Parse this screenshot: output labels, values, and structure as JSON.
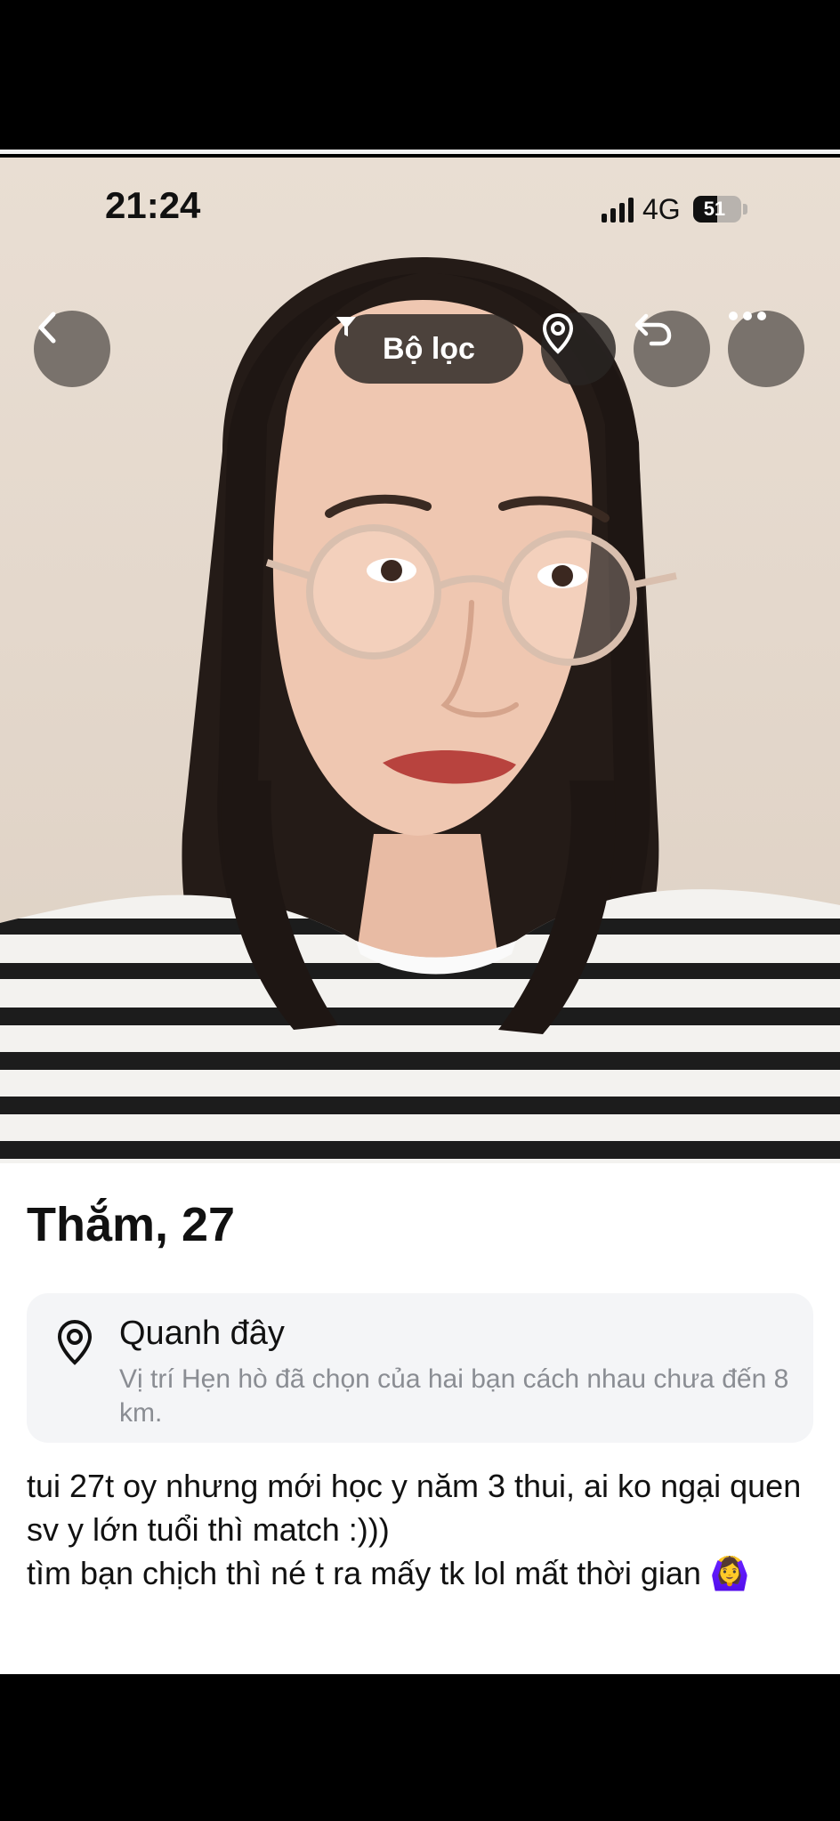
{
  "status_bar": {
    "time": "21:24",
    "network": "4G",
    "battery": "51",
    "battery_level": 0.51
  },
  "toolbar": {
    "back_icon": "chevron-left-icon",
    "filter_label": "Bộ lọc",
    "filter_icon": "funnel-icon",
    "location_icon": "map-pin-icon",
    "undo_icon": "undo-icon",
    "more_icon": "ellipsis-icon"
  },
  "profile": {
    "name_age": "Thắm, 27",
    "location": {
      "icon": "map-pin-icon",
      "title": "Quanh đây",
      "description": "Vị trí Hẹn hò đã chọn của hai bạn cách nhau chưa đến 8 km."
    },
    "bio": "tui 27t oy nhưng mới học y năm 3 thui, ai ko ngại quen sv y lớn tuổi thì match :)))\ntìm bạn chịch thì né t ra mấy tk lol mất thời gian 🙆‍♀️"
  },
  "colors": {
    "photo_background": "#e6dacf",
    "button_overlay": "#5a5450",
    "location_box": "#f4f5f7",
    "secondary_text": "#8a8d93"
  }
}
